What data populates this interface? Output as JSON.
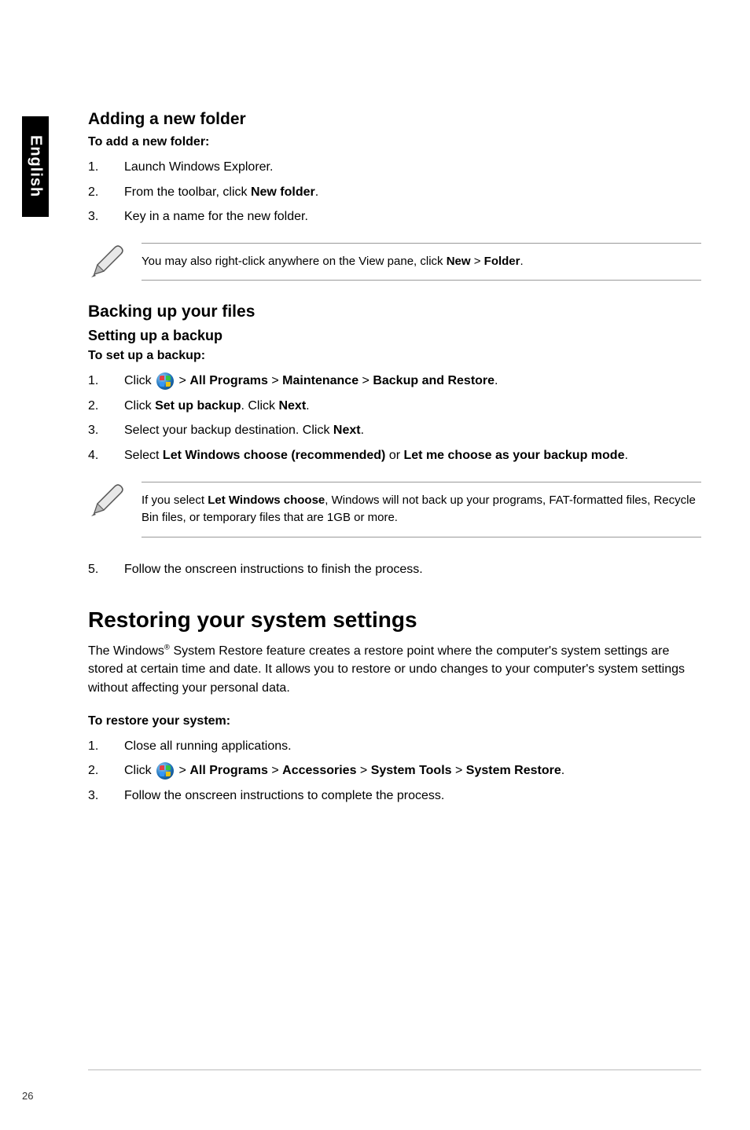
{
  "sideTab": "English",
  "section1": {
    "heading": "Adding a new folder",
    "sub": "To add a new folder:",
    "steps": [
      {
        "n": "1.",
        "pre": "Launch Windows Explorer."
      },
      {
        "n": "2.",
        "pre": "From the toolbar, click ",
        "b1": "New folder",
        "post": "."
      },
      {
        "n": "3.",
        "pre": "Key in a name for the new folder."
      }
    ],
    "note": {
      "t1": "You may also right-click anywhere on the View pane, click ",
      "b1": "New",
      "t2": " > ",
      "b2": "Folder",
      "t3": "."
    }
  },
  "section2": {
    "heading": "Backing up your files",
    "sub1": "Setting up a backup",
    "sub2": "To set up a backup:",
    "steps": [
      {
        "n": "1.",
        "pre": "Click ",
        "orb": true,
        "t1": " > ",
        "b1": "All Programs",
        "t2": " > ",
        "b2": "Maintenance",
        "t3": " > ",
        "b3": "Backup and Restore",
        "post": "."
      },
      {
        "n": "2.",
        "pre": "Click ",
        "b1": "Set up backup",
        "t1": ". Click ",
        "b2": "Next",
        "post": "."
      },
      {
        "n": "3.",
        "pre": "Select your backup destination. Click ",
        "b1": "Next",
        "post": "."
      },
      {
        "n": "4.",
        "pre": "Select ",
        "b1": "Let Windows choose (recommended)",
        "t1": " or ",
        "b2": "Let me choose as your backup mode",
        "post": "."
      }
    ],
    "note": {
      "t1": "If you select ",
      "b1": "Let Windows choose",
      "t2": ", Windows will not back up your programs, FAT-formatted files, Recycle Bin files, or temporary files that are 1GB or more."
    },
    "step5": {
      "n": "5.",
      "pre": "Follow the onscreen instructions to finish the process."
    }
  },
  "section3": {
    "heading": "Restoring your system settings",
    "para": {
      "t1": "The Windows",
      "sup": "®",
      "t2": " System Restore feature creates a restore point where the computer's system settings are stored at certain time and date. It allows you to restore or undo changes to your computer's system settings without affecting your personal data."
    },
    "sub": "To restore your system:",
    "steps": [
      {
        "n": "1.",
        "pre": "Close all running applications."
      },
      {
        "n": "2.",
        "pre": "Click ",
        "orb": true,
        "t1": " > ",
        "b1": "All Programs",
        "t2": " > ",
        "b2": "Accessories",
        "t3": " > ",
        "b3": "System Tools",
        "t4": " > ",
        "b4": "System Restore",
        "post": "."
      },
      {
        "n": "3.",
        "pre": "Follow the onscreen instructions to complete the process."
      }
    ]
  },
  "pageNumber": "26"
}
